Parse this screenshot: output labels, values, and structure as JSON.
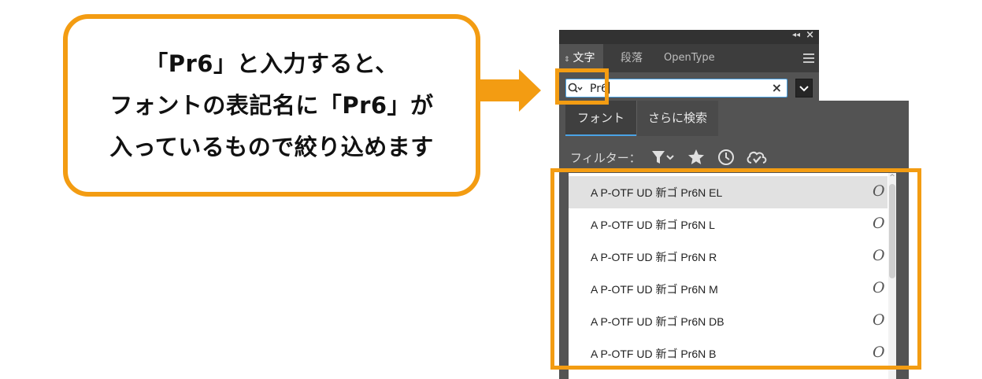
{
  "callout": {
    "lines": [
      "「Pr6」と入力すると、",
      "フォントの表記名に「Pr6」が",
      "入っているもので絞り込めます"
    ]
  },
  "panel": {
    "collapse_icon": "double-chevron-left-icon",
    "close_label": "×",
    "tabs": [
      {
        "label": "文字"
      },
      {
        "label": "段落"
      },
      {
        "label": "OpenType"
      }
    ],
    "menu_icon": "hamburger-menu-icon"
  },
  "search": {
    "value": "Pr6",
    "clear_label": "×",
    "icon": "search-icon"
  },
  "popup": {
    "tabs": [
      {
        "label": "フォント"
      },
      {
        "label": "さらに検索"
      }
    ],
    "filter_label": "フィルター：",
    "fonts": [
      {
        "name": "A P-OTF UD 新ゴ Pr6N EL",
        "type_icon": "O",
        "selected": true
      },
      {
        "name": "A P-OTF UD 新ゴ Pr6N L",
        "type_icon": "O"
      },
      {
        "name": "A P-OTF UD 新ゴ Pr6N R",
        "type_icon": "O"
      },
      {
        "name": "A P-OTF UD 新ゴ Pr6N M",
        "type_icon": "O"
      },
      {
        "name": "A P-OTF UD 新ゴ Pr6N DB",
        "type_icon": "O"
      },
      {
        "name": "A P-OTF UD 新ゴ Pr6N B",
        "type_icon": "O"
      }
    ]
  },
  "colors": {
    "highlight": "#f39c12",
    "panel_bg": "#535353",
    "accent_blue": "#4aa3e6"
  }
}
